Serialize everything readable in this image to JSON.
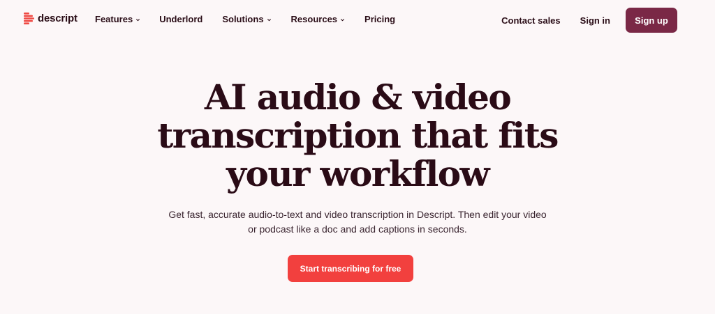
{
  "brand": {
    "name": "descript",
    "logo_icon": "descript-logo-icon",
    "mark_color": "#ef4a44"
  },
  "nav": {
    "items": [
      {
        "label": "Features",
        "has_dropdown": true
      },
      {
        "label": "Underlord",
        "has_dropdown": false
      },
      {
        "label": "Solutions",
        "has_dropdown": true
      },
      {
        "label": "Resources",
        "has_dropdown": true
      },
      {
        "label": "Pricing",
        "has_dropdown": false
      }
    ],
    "contact_sales": "Contact sales",
    "sign_in": "Sign in",
    "sign_up": "Sign up",
    "sign_up_color": "#7a2846"
  },
  "hero": {
    "title_lines": [
      "AI audio & video",
      "transcription that fits",
      "your workflow"
    ],
    "subtitle_lines": [
      "Get fast, accurate audio-to-text and video transcription in Descript. Then edit your video",
      "or podcast like a doc and add captions in seconds."
    ],
    "cta_label": "Start transcribing for free",
    "cta_color": "#f2403e"
  },
  "colors": {
    "background": "#fcf7f8",
    "text": "#2a0d17"
  }
}
